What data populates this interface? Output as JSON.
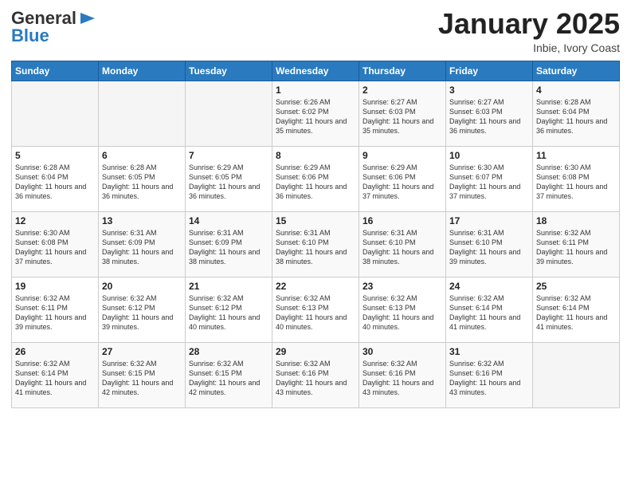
{
  "header": {
    "logo_line1": "General",
    "logo_line2": "Blue",
    "month": "January 2025",
    "location": "Inbie, Ivory Coast"
  },
  "days_of_week": [
    "Sunday",
    "Monday",
    "Tuesday",
    "Wednesday",
    "Thursday",
    "Friday",
    "Saturday"
  ],
  "weeks": [
    [
      {
        "day": "",
        "data": ""
      },
      {
        "day": "",
        "data": ""
      },
      {
        "day": "",
        "data": ""
      },
      {
        "day": "1",
        "data": "Sunrise: 6:26 AM\nSunset: 6:02 PM\nDaylight: 11 hours and 35 minutes."
      },
      {
        "day": "2",
        "data": "Sunrise: 6:27 AM\nSunset: 6:03 PM\nDaylight: 11 hours and 35 minutes."
      },
      {
        "day": "3",
        "data": "Sunrise: 6:27 AM\nSunset: 6:03 PM\nDaylight: 11 hours and 36 minutes."
      },
      {
        "day": "4",
        "data": "Sunrise: 6:28 AM\nSunset: 6:04 PM\nDaylight: 11 hours and 36 minutes."
      }
    ],
    [
      {
        "day": "5",
        "data": "Sunrise: 6:28 AM\nSunset: 6:04 PM\nDaylight: 11 hours and 36 minutes."
      },
      {
        "day": "6",
        "data": "Sunrise: 6:28 AM\nSunset: 6:05 PM\nDaylight: 11 hours and 36 minutes."
      },
      {
        "day": "7",
        "data": "Sunrise: 6:29 AM\nSunset: 6:05 PM\nDaylight: 11 hours and 36 minutes."
      },
      {
        "day": "8",
        "data": "Sunrise: 6:29 AM\nSunset: 6:06 PM\nDaylight: 11 hours and 36 minutes."
      },
      {
        "day": "9",
        "data": "Sunrise: 6:29 AM\nSunset: 6:06 PM\nDaylight: 11 hours and 37 minutes."
      },
      {
        "day": "10",
        "data": "Sunrise: 6:30 AM\nSunset: 6:07 PM\nDaylight: 11 hours and 37 minutes."
      },
      {
        "day": "11",
        "data": "Sunrise: 6:30 AM\nSunset: 6:08 PM\nDaylight: 11 hours and 37 minutes."
      }
    ],
    [
      {
        "day": "12",
        "data": "Sunrise: 6:30 AM\nSunset: 6:08 PM\nDaylight: 11 hours and 37 minutes."
      },
      {
        "day": "13",
        "data": "Sunrise: 6:31 AM\nSunset: 6:09 PM\nDaylight: 11 hours and 38 minutes."
      },
      {
        "day": "14",
        "data": "Sunrise: 6:31 AM\nSunset: 6:09 PM\nDaylight: 11 hours and 38 minutes."
      },
      {
        "day": "15",
        "data": "Sunrise: 6:31 AM\nSunset: 6:10 PM\nDaylight: 11 hours and 38 minutes."
      },
      {
        "day": "16",
        "data": "Sunrise: 6:31 AM\nSunset: 6:10 PM\nDaylight: 11 hours and 38 minutes."
      },
      {
        "day": "17",
        "data": "Sunrise: 6:31 AM\nSunset: 6:10 PM\nDaylight: 11 hours and 39 minutes."
      },
      {
        "day": "18",
        "data": "Sunrise: 6:32 AM\nSunset: 6:11 PM\nDaylight: 11 hours and 39 minutes."
      }
    ],
    [
      {
        "day": "19",
        "data": "Sunrise: 6:32 AM\nSunset: 6:11 PM\nDaylight: 11 hours and 39 minutes."
      },
      {
        "day": "20",
        "data": "Sunrise: 6:32 AM\nSunset: 6:12 PM\nDaylight: 11 hours and 39 minutes."
      },
      {
        "day": "21",
        "data": "Sunrise: 6:32 AM\nSunset: 6:12 PM\nDaylight: 11 hours and 40 minutes."
      },
      {
        "day": "22",
        "data": "Sunrise: 6:32 AM\nSunset: 6:13 PM\nDaylight: 11 hours and 40 minutes."
      },
      {
        "day": "23",
        "data": "Sunrise: 6:32 AM\nSunset: 6:13 PM\nDaylight: 11 hours and 40 minutes."
      },
      {
        "day": "24",
        "data": "Sunrise: 6:32 AM\nSunset: 6:14 PM\nDaylight: 11 hours and 41 minutes."
      },
      {
        "day": "25",
        "data": "Sunrise: 6:32 AM\nSunset: 6:14 PM\nDaylight: 11 hours and 41 minutes."
      }
    ],
    [
      {
        "day": "26",
        "data": "Sunrise: 6:32 AM\nSunset: 6:14 PM\nDaylight: 11 hours and 41 minutes."
      },
      {
        "day": "27",
        "data": "Sunrise: 6:32 AM\nSunset: 6:15 PM\nDaylight: 11 hours and 42 minutes."
      },
      {
        "day": "28",
        "data": "Sunrise: 6:32 AM\nSunset: 6:15 PM\nDaylight: 11 hours and 42 minutes."
      },
      {
        "day": "29",
        "data": "Sunrise: 6:32 AM\nSunset: 6:16 PM\nDaylight: 11 hours and 43 minutes."
      },
      {
        "day": "30",
        "data": "Sunrise: 6:32 AM\nSunset: 6:16 PM\nDaylight: 11 hours and 43 minutes."
      },
      {
        "day": "31",
        "data": "Sunrise: 6:32 AM\nSunset: 6:16 PM\nDaylight: 11 hours and 43 minutes."
      },
      {
        "day": "",
        "data": ""
      }
    ]
  ]
}
